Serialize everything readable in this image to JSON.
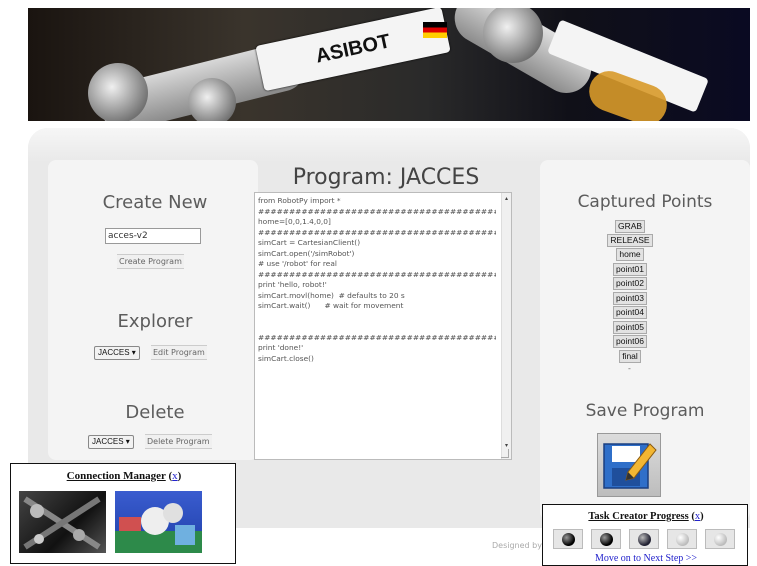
{
  "banner": {
    "robot_label": "ASIBOT",
    "robot_label_2": "ASIBOT"
  },
  "left": {
    "create_title": "Create New",
    "create_input_value": "acces-v2",
    "create_button": "Create Program",
    "explorer_title": "Explorer",
    "explorer_select": "JACCES",
    "edit_button": "Edit Program",
    "delete_title": "Delete",
    "delete_select": "JACCES",
    "delete_button": "Delete Program"
  },
  "program": {
    "title": "Program: JACCES",
    "code": "from RobotPy import *\n############################################\nhome=[0,0,1.4,0,0]\n############################################\nsimCart = CartesianClient()\nsimCart.open('/simRobot')\n# use '/robot' for real\n############################################\nprint 'hello, robot!'\nsimCart.movl(home)  # defaults to 20 s\nsimCart.wait()      # wait for movement\n\n\n############################################\nprint 'done!'\nsimCart.close()"
  },
  "right": {
    "captured_title": "Captured Points",
    "points": [
      "GRAB",
      "RELEASE",
      "home",
      "point01",
      "point02",
      "point03",
      "point04",
      "point05",
      "point06",
      "final"
    ],
    "dot": "-",
    "save_title": "Save Program"
  },
  "connection": {
    "title": "Connection Manager",
    "close": "x"
  },
  "footer": {
    "designed": "Designed by"
  },
  "task": {
    "title": "Task Creator Progress",
    "close": "x",
    "next": "Move on to Next Step >>",
    "steps_completed": 3,
    "steps_total": 5
  }
}
